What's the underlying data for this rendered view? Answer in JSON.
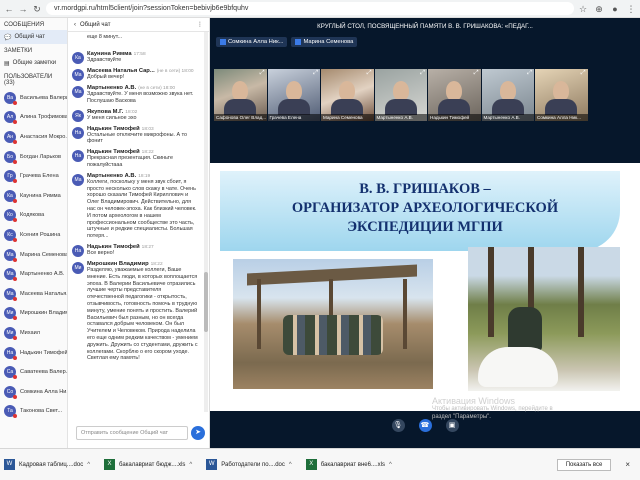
{
  "browser": {
    "url": "vr.mordgpi.ru/html5client/join?sessionToken=bebivjb6e9bfquhv"
  },
  "left_nav": {
    "messages_header": "СООБЩЕНИЯ",
    "public_chat": "Общий чат",
    "notes_header": "ЗАМЕТКИ",
    "shared_notes": "Общие заметки",
    "users_header": "ПОЛЬЗОВАТЕЛИ (33)",
    "users": [
      {
        "initials": "Ва",
        "name": "Васильева Валерия..."
      },
      {
        "initials": "Ал",
        "name": "Алина Трофимова"
      },
      {
        "initials": "Ан",
        "name": "Анастасия Мокро..."
      },
      {
        "initials": "Бо",
        "name": "Богдан Ларьков"
      },
      {
        "initials": "Гр",
        "name": "Грачева Елена"
      },
      {
        "initials": "Ка",
        "name": "Каунина Римма"
      },
      {
        "initials": "Ко",
        "name": "Кодякова"
      },
      {
        "initials": "Кс",
        "name": "Ксения Рошина"
      },
      {
        "initials": "Ма",
        "name": "Марина Семенова"
      },
      {
        "initials": "Ма",
        "name": "Мартыненко А.В."
      },
      {
        "initials": "Ма",
        "name": "Масеева Наталья..."
      },
      {
        "initials": "Ми",
        "name": "Мирошкин Владим..."
      },
      {
        "initials": "Ми",
        "name": "Михаил"
      },
      {
        "initials": "На",
        "name": "Надькин Тимофей"
      },
      {
        "initials": "Са",
        "name": "Саватеева Валер..."
      },
      {
        "initials": "Со",
        "name": "Сомкина Алла Ни..."
      },
      {
        "initials": "Та",
        "name": "Таконова Свет..."
      }
    ]
  },
  "chat": {
    "title": "Общий чат",
    "input_placeholder": "Отправить сообщение Общий чат",
    "messages": [
      {
        "initials": "",
        "name": "",
        "time": "",
        "text": "еще 8 минут..."
      },
      {
        "initials": "Ка",
        "name": "Каунина Римма",
        "time": "17:58",
        "text": "Здравствуйте"
      },
      {
        "initials": "Ма",
        "name": "Масеева Наталья Сар...",
        "time": "(не в сети) 18:00",
        "text": "Добрый вечер!"
      },
      {
        "initials": "Ма",
        "name": "Мартыненко А.В.",
        "time": "(не в сети) 18:00",
        "text": "Здравствуйте. У меня возможно звука нет. Послушаю Васкова"
      },
      {
        "initials": "Як",
        "name": "Якупова М.Г.",
        "time": "18:02",
        "text": "У меня сильное эхо"
      },
      {
        "initials": "На",
        "name": "Надькин Тимофей",
        "time": "18:03",
        "text": "Остальные отключите микрофоны. А то фонит"
      },
      {
        "initials": "На",
        "name": "Надькин Тимофей",
        "time": "18:22",
        "text": "Прекрасная презентация. Скиньте пожалуйстааа"
      },
      {
        "initials": "Ма",
        "name": "Мартыненко А.В.",
        "time": "18:19",
        "text": "Коллеги, поскольку у меня звук сбоит, я просто несколько слов скажу в чате. Очень хорошо сказали Тимофей Кириллович и Олег Владимирович. Действительно, для нас он человек-эпоха. Как близкий человек. И потом археологом в нашем профессиональном сообществе это часть, штучные и редкие специалисты. Большая потеря..."
      },
      {
        "initials": "На",
        "name": "Надькин Тимофей",
        "time": "18:27",
        "text": "Все верно!"
      },
      {
        "initials": "Ми",
        "name": "Мирошкин Владимир",
        "time": "18:22",
        "text": "Разделяю, уважаемые коллеги, Ваше мнение. Есть люди, в которых воплощается эпоха. В Валерии Васильевиче отразились лучшие черты представителя отечественной педагогики - открытость, отзывчивость, готовность помочь в трудную минуту, умение понять и простить. Валерий Васильевич был разным, но он всегда оставался добрым человеком. Он был Учителем и Человеком. Природа наделила его еще одним редким качеством - умением дружить. Дружить со студентами, дружить с коллегами. Скорблю о его скором уходе. Светлая ему память!"
      }
    ]
  },
  "main": {
    "title": "КРУГЛЫЙ СТОЛ, ПОСВЯЩЕННЫЙ ПАМЯТИ В. В. ГРИШАКОВА: «ПЕДАГ...",
    "presenter_1": "Сомкина Алла Ник...",
    "presenter_2": "Марина Семенова",
    "video_tiles": [
      "Сафонова Олег Влад...",
      "Грачева Елена",
      "Марина Семенова",
      "Мартыненко А.В.",
      "Надькин Тимофей",
      "Мартыненко А.В.",
      "Сомкина Алла Ник..."
    ],
    "slide_title_1": "В. В. ГРИШАКОВ –",
    "slide_title_2": "ОРГАНИЗАТОР АРХЕОЛОГИЧЕСКОЙ",
    "slide_title_3": "ЭКСПЕДИЦИИ МГПИ"
  },
  "activation": {
    "title": "Активация Windows",
    "line1": "Чтобы активировать Windows, перейдите в",
    "line2": "раздел \"Параметры\"."
  },
  "taskbar": {
    "items": [
      {
        "icon": "W",
        "label": "Кадровая таблиц....doc"
      },
      {
        "icon": "X",
        "label": "бакалавриат бюдж....xls"
      },
      {
        "icon": "W",
        "label": "Работодатели по....doc"
      },
      {
        "icon": "X",
        "label": "бакалавриат вне6....xls"
      }
    ],
    "show_all": "Показать все",
    "close": "×"
  }
}
